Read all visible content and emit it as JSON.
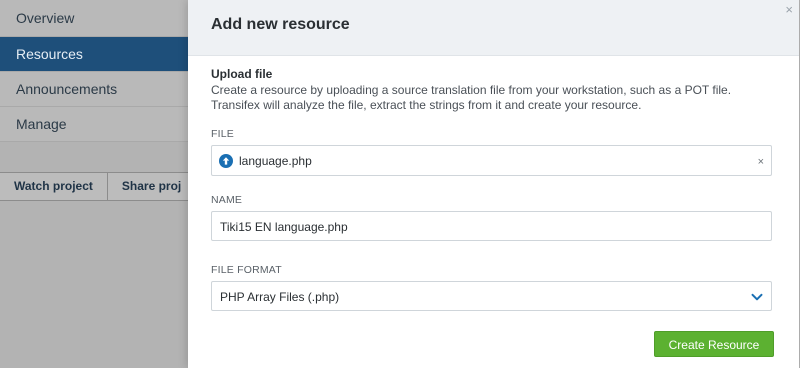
{
  "sidebar": {
    "items": [
      {
        "label": "Overview"
      },
      {
        "label": "Resources"
      },
      {
        "label": "Announcements"
      },
      {
        "label": "Manage"
      }
    ],
    "actions": {
      "watch": "Watch project",
      "share": "Share proj"
    }
  },
  "modal": {
    "title": "Add new resource",
    "close": "×",
    "section_title": "Upload file",
    "description": "Create a resource by uploading a source translation file from your workstation, such as a POT file. Transifex will analyze the file, extract the strings from it and create your resource.",
    "file": {
      "label": "FILE",
      "value": "language.php",
      "clear": "×",
      "icon": "upload-icon"
    },
    "name": {
      "label": "NAME",
      "value": "Tiki15 EN language.php"
    },
    "format": {
      "label": "FILE FORMAT",
      "value": "PHP Array Files (.php)",
      "icon": "chevron-down-icon"
    },
    "submit_label": "Create Resource"
  },
  "colors": {
    "active_nav": "#1e4f7a",
    "primary_button": "#5cb131",
    "accent_blue": "#1a6fb3"
  }
}
